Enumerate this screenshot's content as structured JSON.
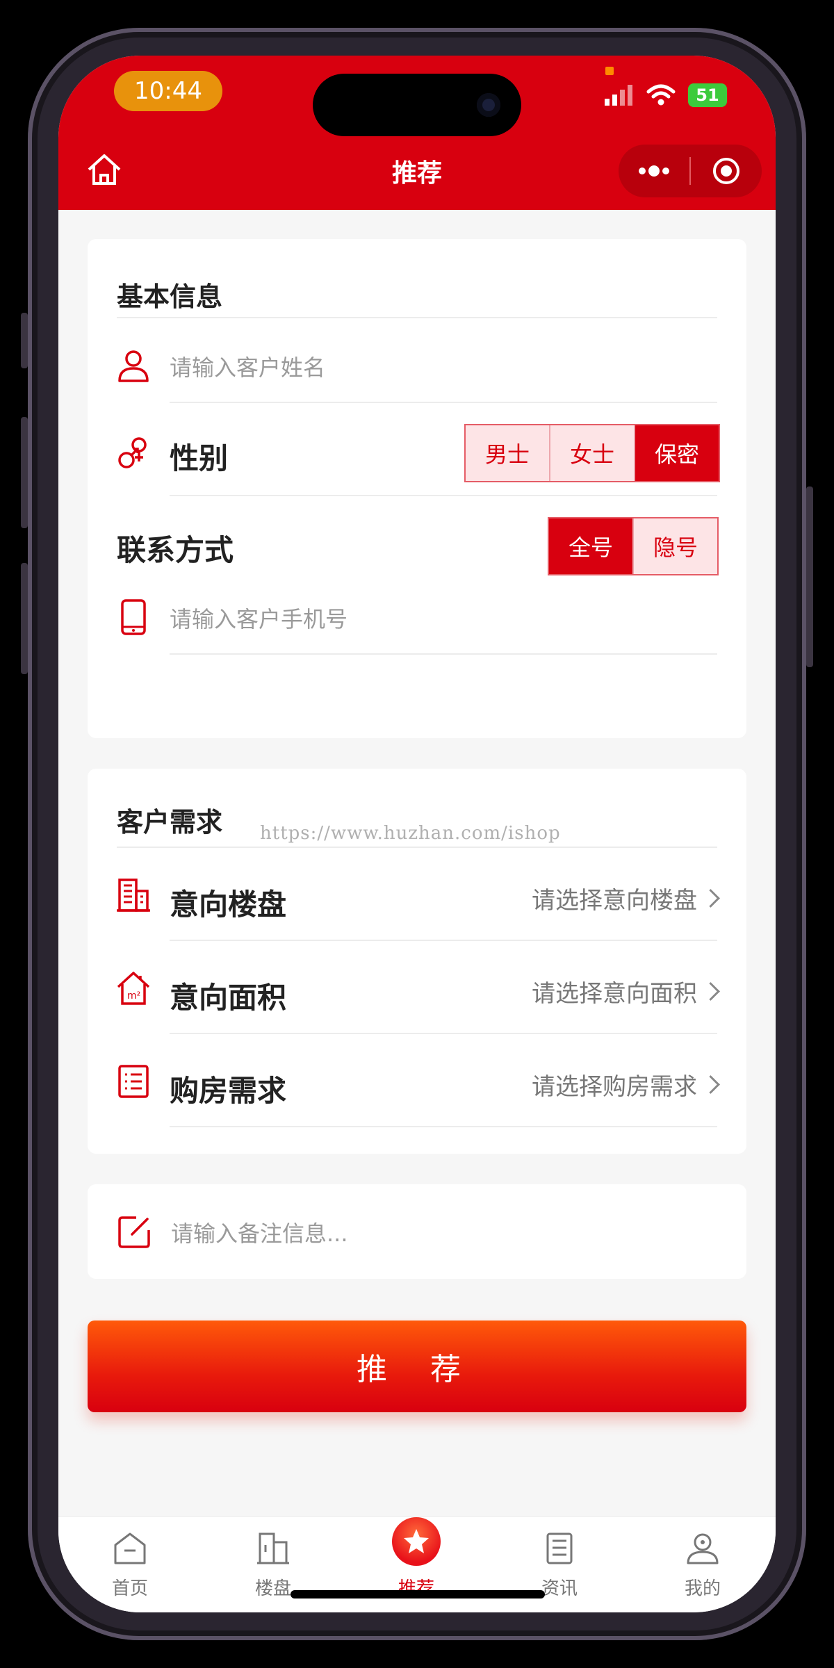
{
  "status_bar": {
    "time": "10:44",
    "battery": "51"
  },
  "nav": {
    "title": "推荐"
  },
  "basic_info": {
    "title": "基本信息",
    "name_placeholder": "请输入客户姓名",
    "gender_label": "性别",
    "gender_options": [
      "男士",
      "女士",
      "保密"
    ],
    "gender_selected": "保密",
    "contact_label": "联系方式",
    "contact_options": [
      "全号",
      "隐号"
    ],
    "contact_selected": "全号",
    "phone_placeholder": "请输入客户手机号"
  },
  "demand": {
    "title": "客户需求",
    "rows": [
      {
        "label": "意向楼盘",
        "value": "请选择意向楼盘",
        "icon": "building-icon"
      },
      {
        "label": "意向面积",
        "value": "请选择意向面积",
        "icon": "area-house-icon"
      },
      {
        "label": "购房需求",
        "value": "请选择购房需求",
        "icon": "list-doc-icon"
      }
    ]
  },
  "remark": {
    "placeholder": "请输入备注信息..."
  },
  "submit_label": "推 荐",
  "watermark": "https://www.huzhan.com/ishop",
  "tabbar": {
    "items": [
      {
        "label": "首页",
        "icon": "home-tab-icon"
      },
      {
        "label": "楼盘",
        "icon": "building-tab-icon"
      },
      {
        "label": "推荐",
        "icon": "star-tab-icon",
        "active": true
      },
      {
        "label": "资讯",
        "icon": "news-tab-icon"
      },
      {
        "label": "我的",
        "icon": "user-tab-icon"
      }
    ]
  },
  "colors": {
    "primary": "#d8000f",
    "button_top": "#ff5a0a",
    "time_pill": "#e8920c",
    "battery": "#3ccb3c"
  }
}
